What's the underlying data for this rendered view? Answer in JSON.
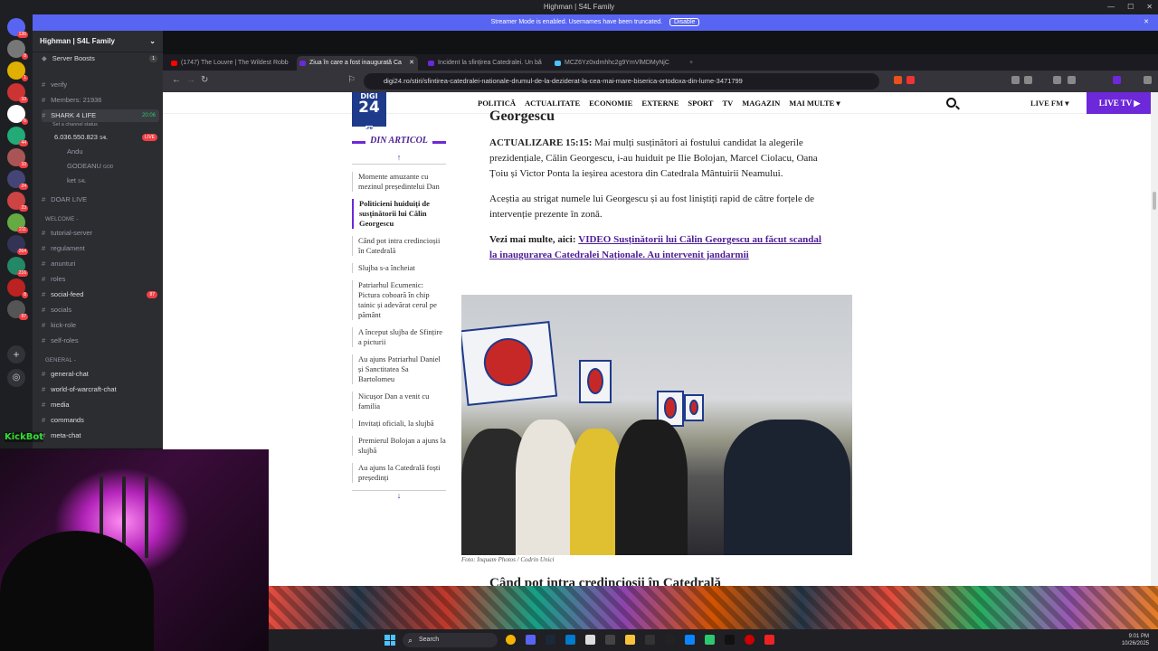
{
  "window": {
    "title": "Highman | S4L Family"
  },
  "banner": {
    "text": "Streamer Mode is enabled. Usernames have been truncated.",
    "button": "Disable"
  },
  "servers": [
    {
      "badge": "136"
    },
    {
      "badge": "8"
    },
    {
      "badge": "1"
    },
    {
      "badge": "10"
    },
    {
      "badge": "6"
    },
    {
      "badge": "44"
    },
    {
      "badge": "10"
    },
    {
      "badge": "24"
    },
    {
      "badge": "23"
    },
    {
      "badge": "211"
    },
    {
      "badge": "264"
    },
    {
      "badge": "216"
    },
    {
      "badge": "8"
    },
    {
      "badge": "97"
    }
  ],
  "discord": {
    "server_name": "Highman | S4L Family",
    "boosts": {
      "label": "Server Boosts",
      "count": "1"
    },
    "channels": [
      {
        "name": "verify"
      },
      {
        "name": "Members: 21936"
      },
      {
        "name": "SHARK 4 LIFE",
        "time": "20:06"
      },
      {
        "name": "Set a channel status"
      },
      {
        "name": "6.036.550.823",
        "tag": "S4L",
        "badge": "LIVE"
      },
      {
        "name": "Andu"
      },
      {
        "name": "GODEANU",
        "tag": "GOD"
      },
      {
        "name": "ket",
        "tag": "S4L"
      },
      {
        "name": "DOAR LIVE"
      }
    ],
    "cat_welcome": "WELCOME -",
    "welcome_channels": [
      {
        "name": "tutorial-server"
      },
      {
        "name": "regulament"
      },
      {
        "name": "anunturi"
      },
      {
        "name": "roles"
      },
      {
        "name": "social-feed",
        "badge": "87"
      },
      {
        "name": "socials"
      },
      {
        "name": "kick-role"
      },
      {
        "name": "self-roles"
      }
    ],
    "cat_general": "GENERAL -",
    "general_channels": [
      {
        "name": "general-chat"
      },
      {
        "name": "world-of-warcraft-chat"
      },
      {
        "name": "media"
      },
      {
        "name": "commands"
      },
      {
        "name": "meta-chat"
      }
    ]
  },
  "tabs": [
    {
      "label": "(1747) The Louvre | The Wildest Robb",
      "color": "#ff0000"
    },
    {
      "label": "Ziua în care a fost inaugurată Ca",
      "color": "#6d28d9"
    },
    {
      "label": "Incident la sfințirea Catedralei. Un bă",
      "color": "#6d28d9"
    },
    {
      "label": "MCZ6Yz0xdmhhc2g9YmVlMDMyNjC",
      "color": "#4cc2ff"
    }
  ],
  "address": {
    "url": "digi24.ro/stiri/sfintirea-catedralei-nationale-drumul-de-la-deziderat-la-cea-mai-mare-biserica-ortodoxa-din-lume-3471799"
  },
  "site": {
    "logo": {
      "top": "DIGI",
      "num": "24",
      "sub": ".ro"
    },
    "menu": [
      "POLITICĂ",
      "ACTUALITATE",
      "ECONOMIE",
      "EXTERNE",
      "SPORT",
      "TV",
      "MAGAZIN",
      "MAI MULTE"
    ],
    "live_fm": "LIVE FM",
    "live_tv": "LIVE TV"
  },
  "toc": {
    "title": "DIN ARTICOL",
    "items": [
      "Momente amuzante cu mezinul președintelui Dan",
      "Politicieni huiduiți de susținătorii lui Călin Georgescu",
      "Când pot intra credincioșii în Catedrală",
      "Slujba s-a încheiat",
      "Patriarhul Ecumenic: Pictura coboară în chip tainic și adevărat cerul pe pământ",
      "A început slujba de Sfințire a picturii",
      "Au ajuns Patriarhul Daniel și Sanctitatea Sa Bartolomeu",
      "Nicușor Dan a venit cu familia",
      "Invitați oficiali, la slujbă",
      "Premierul Bolojan a ajuns la slujbă",
      "Au ajuns la Catedrală foști președinți"
    ]
  },
  "article": {
    "heading": "Georgescu",
    "p1_bold": "ACTUALIZARE 15:15:",
    "p1": " Mai mulți susținători ai fostului candidat la alegerile prezidențiale, Călin Georgescu, i-au huiduit pe Ilie Bolojan, Marcel Ciolacu, Oana Țoiu și Victor Ponta la ieșirea acestora din Catedrala Mântuirii Neamului.",
    "p2": "Aceștia au strigat numele lui Georgescu și au fost liniștiți rapid de către forțele de intervenție prezente în zonă.",
    "p3_bold": "Vezi mai multe, aici:",
    "p3_link": "VIDEO Susținătorii lui Călin Georgescu au făcut scandal la inaugurarea Catedralei Naționale. Au intervenit jandarmii",
    "caption": "Foto: Inquam Photos / Codrin Unici",
    "next_heading": "Când pot intra credincioșii în Catedrală"
  },
  "overlay": {
    "kick": "KickBot"
  },
  "taskbar": {
    "search": "Search",
    "time": "9:01 PM",
    "date": "10/26/2025"
  }
}
